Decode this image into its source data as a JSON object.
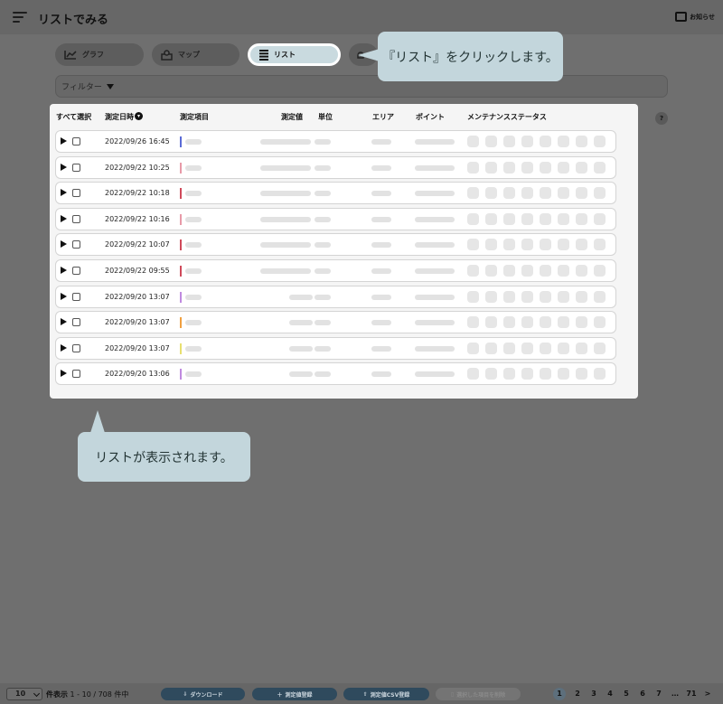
{
  "header": {
    "title": "リストでみる",
    "notice_label": "お知らせ"
  },
  "tabs": [
    {
      "label": "グラフ",
      "icon": "line-chart-icon",
      "active": false
    },
    {
      "label": "マップ",
      "icon": "map-pin-icon",
      "active": false
    },
    {
      "label": "リスト",
      "icon": "list-icon",
      "active": true
    }
  ],
  "filter": {
    "label": "フィルター"
  },
  "table": {
    "headers": {
      "select_all": "すべて選択",
      "datetime": "測定日時",
      "item": "測定項目",
      "value": "測定値",
      "unit": "単位",
      "area": "エリア",
      "point": "ポイント",
      "maintenance_status": "メンテナンスステータス"
    },
    "help": "?",
    "rows": [
      {
        "date": "2022/09/26 16:45",
        "color": "#5a6bd6"
      },
      {
        "date": "2022/09/22 10:25",
        "color": "#e89aa8"
      },
      {
        "date": "2022/09/22 10:18",
        "color": "#d04a5a"
      },
      {
        "date": "2022/09/22 10:16",
        "color": "#e89aa8"
      },
      {
        "date": "2022/09/22 10:07",
        "color": "#d04a5a"
      },
      {
        "date": "2022/09/22 09:55",
        "color": "#d04a5a"
      },
      {
        "date": "2022/09/20 13:07",
        "color": "#c08ae0"
      },
      {
        "date": "2022/09/20 13:07",
        "color": "#f0a040"
      },
      {
        "date": "2022/09/20 13:07",
        "color": "#e8e070"
      },
      {
        "date": "2022/09/20 13:06",
        "color": "#c08ae0"
      }
    ]
  },
  "callouts": {
    "click_list": "『リスト』をクリックします。",
    "list_shown": "リストが表示されます。"
  },
  "footer": {
    "per_page": "10",
    "per_page_label": "件表示",
    "range": "1 - 10 / 708 件中",
    "download": "ダウンロード",
    "register": "測定値登録",
    "csv_register": "測定値CSV登録",
    "delete_selected": "選択した項目を削除",
    "pages": [
      "1",
      "2",
      "3",
      "4",
      "5",
      "6",
      "7",
      "…",
      "71",
      ">"
    ],
    "current_page": "1"
  }
}
